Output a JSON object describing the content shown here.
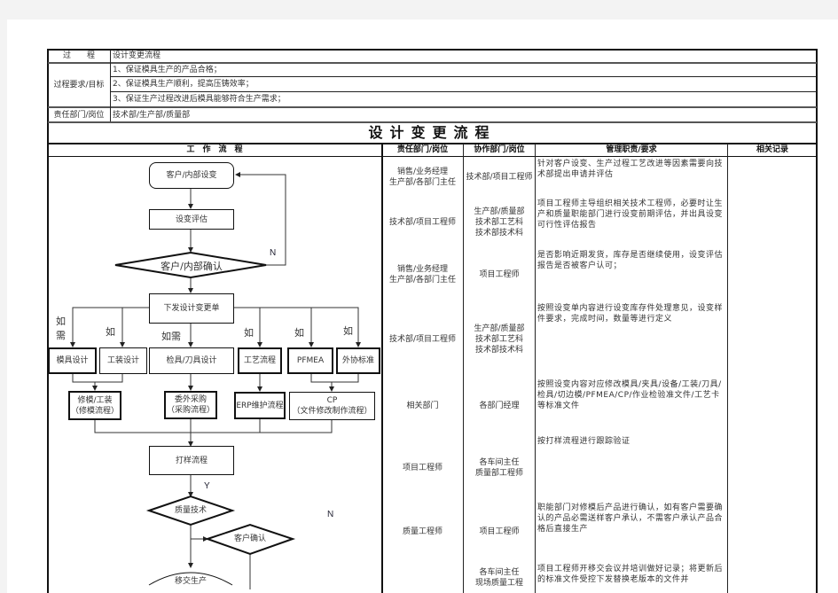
{
  "header": {
    "process_label": "过　　程",
    "process_value": "设计变更流程",
    "requirements_label": "过程要求/目标",
    "requirements": [
      "1、保证模具生产的产品合格；",
      "2、保证模具生产顺利，提高压铸效率；",
      "3、保证生产过程改进后模具能够符合生产需求；"
    ],
    "responsible_label": "责任部门/岗位",
    "responsible_value": "技术部/生产部/质量部",
    "title": "设计变更流程"
  },
  "columns": {
    "workflow": "工　作　流　程",
    "responsible": "责任部门/岗位",
    "cooperate": "协作部门/岗位",
    "management": "管理职责/要求",
    "records": "相关记录"
  },
  "rows": [
    {
      "responsible": "销售/业务经理\n生产部/各部门主任",
      "cooperate": "技术部/项目工程师",
      "management": "针对客户设变、生产过程工艺改进等因素需要向技术部提出申请并评估",
      "records": ""
    },
    {
      "responsible": "技术部/项目工程师",
      "cooperate": "生产部/质量部\n技术部工艺科\n技术部技术科",
      "management": "项目工程师主导组织相关技术工程师，必要时让生产和质量职能部门进行设变前期评估，并出具设变可行性评估报告",
      "records": ""
    },
    {
      "responsible": "销售/业务经理\n生产部/各部门主任",
      "cooperate": "项目工程师",
      "management": "是否影响近期发货，库存是否继续使用，设变评估报告是否被客户认可；",
      "records": ""
    },
    {
      "responsible": "技术部/项目工程师",
      "cooperate": "生产部/质量部\n技术部工艺科\n技术部技术科",
      "management": "按照设变单内容进行设变库存件处理意见，设变样件要求，完成时间，数量等进行定义",
      "records": ""
    },
    {
      "responsible": "相关部门",
      "cooperate": "各部门经理",
      "management": "按照设变内容对应修改模具/夹具/设备/工装/刀具/检具/切边模/PFMEA/CP/作业检验准文件/工艺卡等标准文件",
      "records": ""
    },
    {
      "responsible": "项目工程师",
      "cooperate": "各车间主任\n质量部工程师",
      "management": "按打样流程进行跟踪验证",
      "records": ""
    },
    {
      "responsible": "质量工程师",
      "cooperate": "项目工程师",
      "management": "职能部门对修模后产品进行确认，如有客户需要确认的产品必需送样客户承认，不需客户承认产品合格后直接生产",
      "records": ""
    },
    {
      "responsible": "",
      "cooperate": "各车间主任\n现场质量工程",
      "management": "项目工程师开移交会议并培训做好记录；将更新后的标准文件受控下发替换老版本的文件并",
      "records": ""
    }
  ],
  "flow": {
    "start": "客户/内部设变",
    "evaluate": "设变评估",
    "confirm": "客户/内部确认",
    "confirm_no": "N",
    "issue": "下发设计变更单",
    "if_needed_1": "如\n需",
    "if_1": "如",
    "if_needed_2": "如需",
    "if_3": "如",
    "if_4": "如",
    "if_5": "如",
    "branches": [
      "模具设计",
      "工装设计",
      "检具/刀具设计",
      "工艺流程",
      "PFMEA",
      "外协标准"
    ],
    "sub_1": "修模/工装\n（修模流程）",
    "sub_2": "委外采购\n（采购流程）",
    "sub_3": "ERP维护流程",
    "sub_4": "CP\n（文件修改制作流程）",
    "sample": "打样流程",
    "sample_yes": "Y",
    "quality": "质量技术",
    "customer_confirm": "客户确认",
    "customer_no": "N",
    "handover": "移交生产"
  }
}
